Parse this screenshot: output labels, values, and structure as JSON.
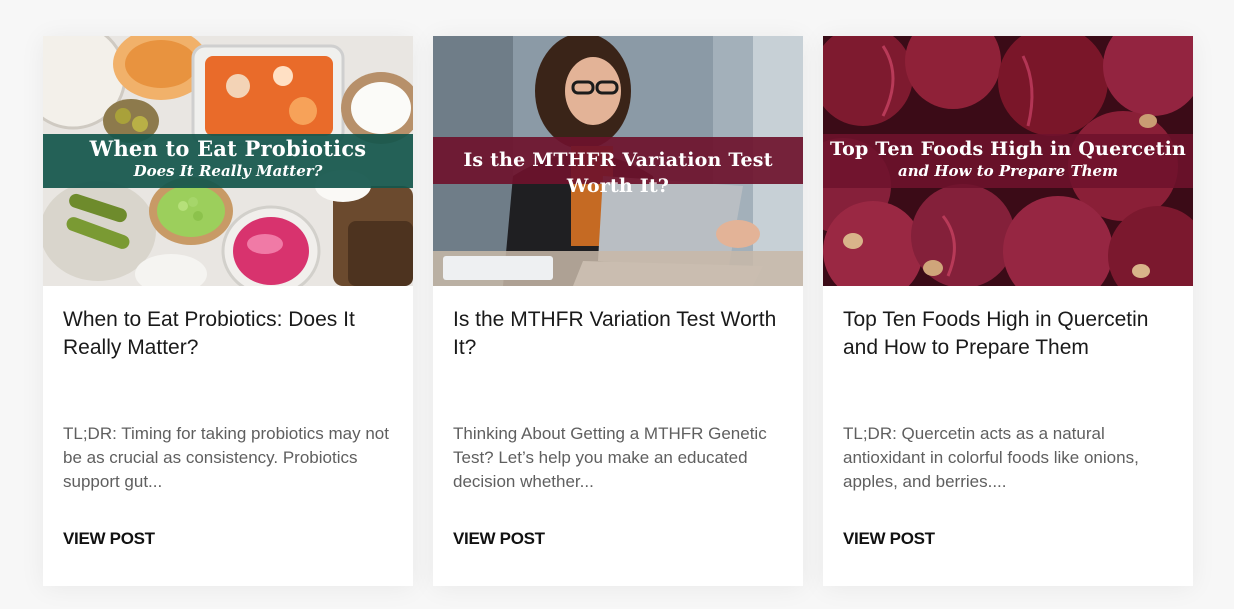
{
  "cards": [
    {
      "image": {
        "banner_title": "When to Eat Probiotics",
        "banner_subtitle": "Does It Really Matter?",
        "banner_color": "#14564c"
      },
      "title": "When to Eat Probiotics: Does It Really Matter?",
      "excerpt": "TL;DR: Timing for taking probiotics may not be as crucial as consistency. Probiotics support gut...",
      "cta": "VIEW POST"
    },
    {
      "image": {
        "banner_title": "Is the MTHFR Variation Test Worth It?",
        "banner_color": "#6e122c"
      },
      "title": "Is the MTHFR Variation Test Worth It?",
      "excerpt": "Thinking About Getting a MTHFR Genetic Test? Let’s help you make an educated decision whether...",
      "cta": "VIEW POST"
    },
    {
      "image": {
        "banner_title": "Top Ten Foods High in Quercetin",
        "banner_subtitle": "and How to Prepare Them",
        "banner_color": "#6e122c"
      },
      "title": "Top Ten Foods High in Quercetin and How to Prepare Them",
      "excerpt": "TL;DR: Quercetin acts as a natural antioxidant in colorful foods like onions, apples, and berries....",
      "cta": "VIEW POST"
    }
  ]
}
